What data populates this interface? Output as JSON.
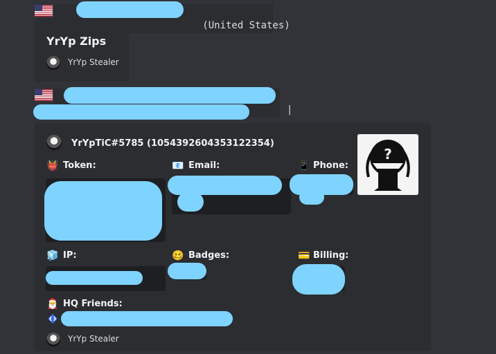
{
  "message1": {
    "code_suffix": " (United States)",
    "embed_title": "YrYp Zips",
    "footer_text": "YrYp Stealer"
  },
  "message2": {
    "code_end": "|",
    "author": "YrYpTiC#5785 (1054392604353122354)",
    "fields": {
      "token_label": "Token:",
      "email_label": "Email:",
      "phone_label": "Phone:",
      "ip_label": "IP:",
      "badges_label": "Badges:",
      "billing_label": "Billing:",
      "hq_label": "HQ Friends:"
    },
    "emojis": {
      "token": "👹",
      "email": "📧",
      "phone": "📱",
      "ip": "🧊",
      "badges": "🥴",
      "billing": "💳",
      "hq": "🎅"
    },
    "footer_text": "YrYp Stealer"
  },
  "icons": [
    "us-flag-icon",
    "avatar-icon",
    "anonymous-mask-icon",
    "hypesquad-badge-icon"
  ],
  "colors": {
    "background": "#313338",
    "embed": "#2b2d31",
    "code_block": "#1e1f22",
    "redaction": "#7fd3ff"
  }
}
